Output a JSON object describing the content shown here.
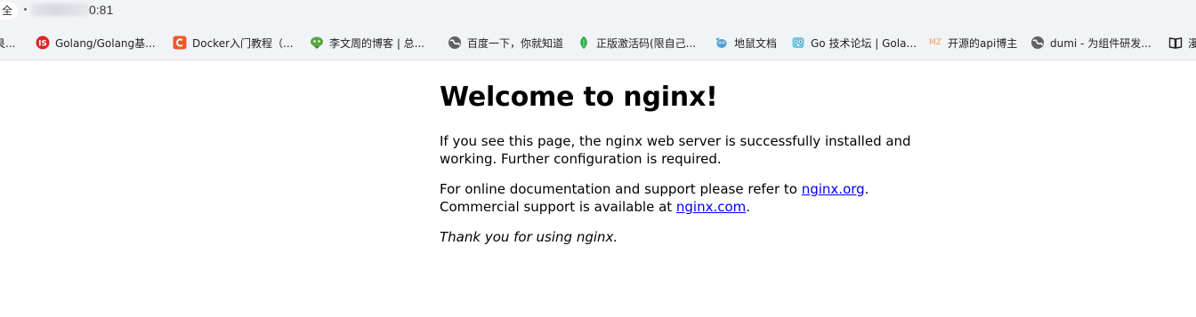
{
  "browser": {
    "security_chip": "全",
    "address_visible": "0:81",
    "bookmarks": [
      {
        "label": "艮...",
        "icon": "cut-off-favicon"
      },
      {
        "label": "Golang/Golang基...",
        "icon": "golang-red-favicon",
        "icon_color": "#e02424"
      },
      {
        "label": "Docker入门教程（...",
        "icon": "docker-c-favicon",
        "icon_color": "#f05a28"
      },
      {
        "label": "李文周的博客 | 总...",
        "icon": "green-avatar-favicon",
        "icon_color": "#58a642"
      },
      {
        "label": "百度一下，你就知道",
        "icon": "globe-icon",
        "icon_color": "#5f6368"
      },
      {
        "label": "正版激活码(限自己...",
        "icon": "green-leaf-favicon",
        "icon_color": "#2eaa48"
      },
      {
        "label": "地鼠文档",
        "icon": "gopher-favicon",
        "icon_color": "#4e9fd8"
      },
      {
        "label": "Go 技术论坛 | Gola...",
        "icon": "gopher-forum-favicon",
        "icon_color": "#6fc7e1"
      },
      {
        "label": "开源的api博主",
        "icon": "mz-favicon",
        "icon_text": "MZ",
        "icon_color": "#e8a04a"
      },
      {
        "label": "dumi - 为组件研发...",
        "icon": "globe-icon",
        "icon_color": "#5f6368"
      },
      {
        "label": "漫",
        "icon": "book-icon",
        "icon_color": "#222222"
      }
    ]
  },
  "page": {
    "heading": "Welcome to nginx!",
    "p1": "If you see this page, the nginx web server is successfully installed and working. Further configuration is required.",
    "p2_prefix": "For online documentation and support please refer to ",
    "link_org": "nginx.org",
    "p2_mid": ".",
    "p2_line2_prefix": "Commercial support is available at ",
    "link_com": "nginx.com",
    "p2_end": ".",
    "p3": "Thank you for using nginx."
  }
}
